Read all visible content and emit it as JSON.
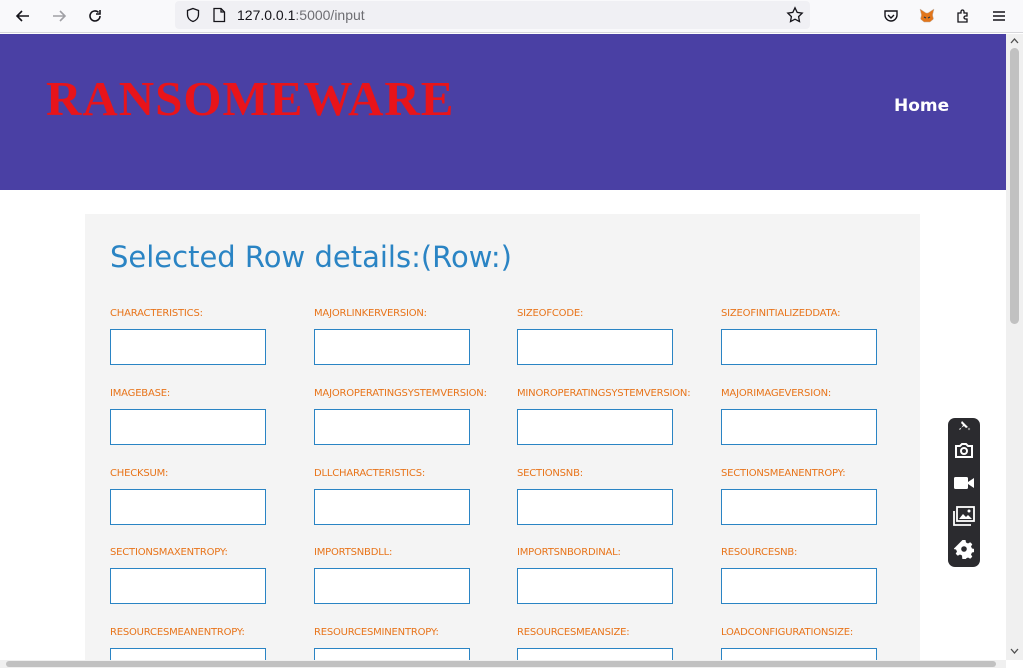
{
  "browser": {
    "url_host": "127.0.0.1",
    "url_path": ":5000/input",
    "icons": [
      "back-icon",
      "forward-icon",
      "reload-icon",
      "shield-icon",
      "page-icon",
      "bookmark-star-icon",
      "pocket-icon",
      "metamask-fox-icon",
      "extensions-icon",
      "menu-icon"
    ]
  },
  "header": {
    "logo": "RANSOMEWARE",
    "home": "Home"
  },
  "colors": {
    "header_bg": "#4a40a4",
    "logo": "#e8141a",
    "title": "#2a84c4",
    "label": "#e8741a",
    "input_border": "#2a84c4"
  },
  "form": {
    "title": "Selected Row details:(Row:)",
    "fields": [
      {
        "label": "CHARACTERISTICS:",
        "value": ""
      },
      {
        "label": "MAJORLINKERVERSION:",
        "value": ""
      },
      {
        "label": "SIZEOFCODE:",
        "value": ""
      },
      {
        "label": "SIZEOFINITIALIZEDDATA:",
        "value": ""
      },
      {
        "label": "IMAGEBASE:",
        "value": ""
      },
      {
        "label": "MAJOROPERATINGSYSTEMVERSION:",
        "value": ""
      },
      {
        "label": "MINOROPERATINGSYSTEMVERSION:",
        "value": ""
      },
      {
        "label": "MAJORIMAGEVERSION:",
        "value": ""
      },
      {
        "label": "CHECKSUM:",
        "value": ""
      },
      {
        "label": "DLLCHARACTERISTICS:",
        "value": ""
      },
      {
        "label": "SECTIONSNB:",
        "value": ""
      },
      {
        "label": "SECTIONSMEANENTROPY:",
        "value": ""
      },
      {
        "label": "SECTIONSMAXENTROPY:",
        "value": ""
      },
      {
        "label": "IMPORTSNBDLL:",
        "value": ""
      },
      {
        "label": "IMPORTSNBORDINAL:",
        "value": ""
      },
      {
        "label": "RESOURCESNB:",
        "value": ""
      },
      {
        "label": "RESOURCESMEANENTROPY:",
        "value": ""
      },
      {
        "label": "RESOURCESMINENTROPY:",
        "value": ""
      },
      {
        "label": "RESOURCESMEANSIZE:",
        "value": ""
      },
      {
        "label": "LOADCONFIGURATIONSIZE:",
        "value": ""
      }
    ]
  },
  "float_toolbar": {
    "icons": [
      "pin-icon",
      "camera-icon",
      "video-icon",
      "gallery-icon",
      "settings-gear-icon"
    ]
  }
}
